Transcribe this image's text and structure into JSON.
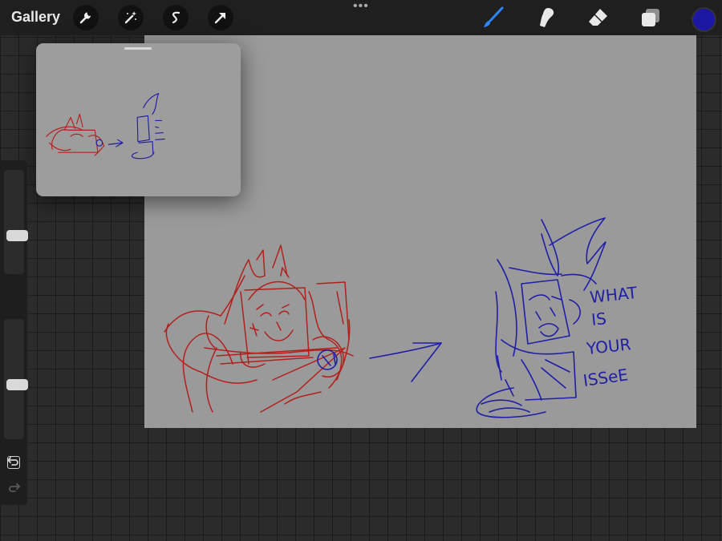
{
  "topbar": {
    "gallery_label": "Gallery",
    "tools_left": [
      "wrench-icon",
      "magic-wand-icon",
      "selection-icon",
      "transform-arrow-icon"
    ],
    "tools_right": [
      "brush-icon",
      "smudge-icon",
      "eraser-icon",
      "layers-icon"
    ],
    "active_tool": "brush-icon",
    "more_menu": "•••"
  },
  "colors": {
    "active_color": "#1d18a3",
    "brush_active": "#2d86ff",
    "red_ink": "#b3201c",
    "blue_ink": "#1f1ea8",
    "canvas_bg": "#9a9a9a"
  },
  "canvas": {
    "handwriting": [
      "WHAT",
      "IS",
      "YOUR",
      "ISSeE"
    ]
  },
  "sidebar": {
    "brush_size_level": 0.35,
    "opacity_level": 0.45,
    "controls": [
      "square-modify-icon",
      "undo-icon",
      "redo-icon"
    ]
  }
}
